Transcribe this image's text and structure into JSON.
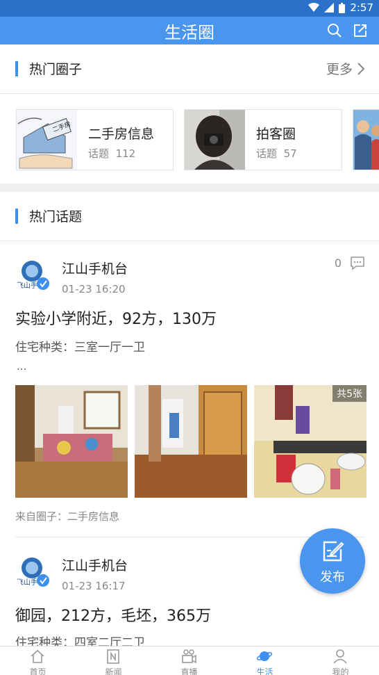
{
  "status_bar": {
    "time": "2:57"
  },
  "header": {
    "title": "生活圈"
  },
  "hot_circles": {
    "title": "热门圈子",
    "more": "更多",
    "items": [
      {
        "name": "二手房信息",
        "topic_label": "话题",
        "topic_count": "112"
      },
      {
        "name": "拍客圈",
        "topic_label": "话题",
        "topic_count": "57"
      }
    ]
  },
  "hot_topics": {
    "title": "热门话题",
    "posts": [
      {
        "author": "江山手机台",
        "avatar_text": "飞山手",
        "time": "01-23 16:20",
        "comments": "0",
        "title": "实验小学附近，92方，130万",
        "subtitle": "住宅种类：三室一厅一卫",
        "ellipsis": "...",
        "photo_count": "共5张",
        "from": "来自圈子：二手房信息"
      },
      {
        "author": "江山手机台",
        "avatar_text": "飞山手",
        "time": "01-23 16:17",
        "title": "御园，212方，毛坯，365万",
        "subtitle": "住宅种类：四室二厅二卫"
      }
    ]
  },
  "fab": {
    "label": "发布"
  },
  "tabs": [
    {
      "label": "首页",
      "icon": "home-icon"
    },
    {
      "label": "新闻",
      "icon": "news-icon"
    },
    {
      "label": "直播",
      "icon": "live-icon"
    },
    {
      "label": "生活",
      "icon": "planet-icon",
      "active": true
    },
    {
      "label": "我的",
      "icon": "person-icon"
    }
  ],
  "colors": {
    "primary": "#4a95ee",
    "status_bar": "#2a72c9",
    "accent_bar": "#3d8ff0"
  }
}
